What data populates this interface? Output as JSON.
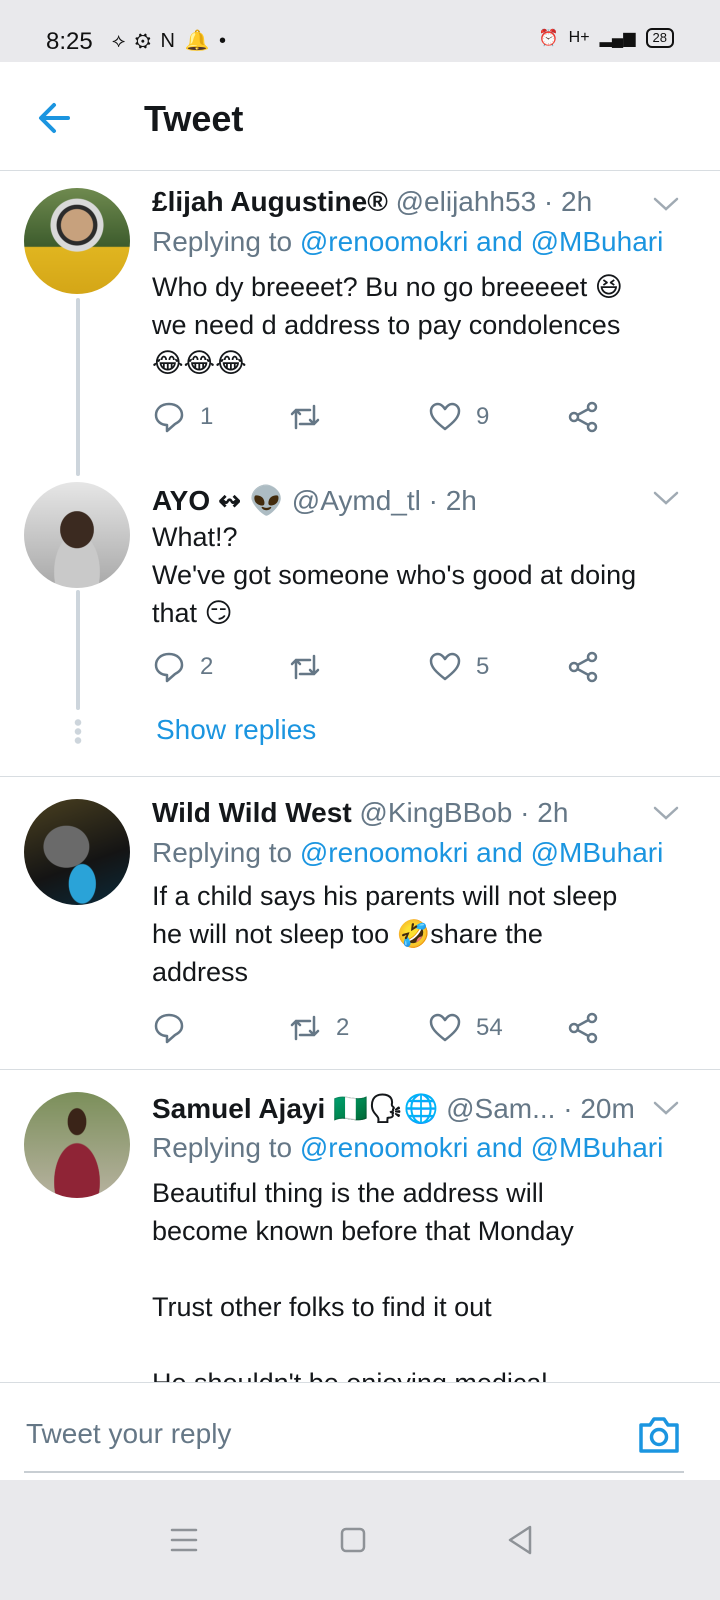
{
  "status_bar": {
    "time": "8:25",
    "left_icons": "⟡ ⚙ N 🔔 •",
    "network": "H+",
    "battery": "28"
  },
  "app_bar": {
    "title": "Tweet"
  },
  "tweets": [
    {
      "name": "£lijah Augustine®",
      "handle": "@elijahh53 · 2h",
      "replying_prefix": "Replying to ",
      "replying_mentions": "@renoomokri and @MBuhari",
      "body": "Who dy breeeet? Bu no go breeeeet 😆\nwe need d address to pay condolences\n😂😂😂",
      "replies": "1",
      "retweets": "",
      "likes": "9"
    },
    {
      "name": "AYO ↭ 👽",
      "handle": "@Aymd_tl · 2h",
      "body": "What!?\nWe've got someone who's good at doing\nthat 😏",
      "replies": "2",
      "retweets": "",
      "likes": "5",
      "show_replies": "Show replies"
    },
    {
      "name": "Wild Wild West",
      "handle": "@KingBBob · 2h",
      "replying_prefix": "Replying to ",
      "replying_mentions": "@renoomokri and @MBuhari",
      "body": "If a child says his parents will not sleep\nhe will not sleep too 🤣share the\naddress",
      "replies": "",
      "retweets": "2",
      "likes": "54"
    },
    {
      "name": "Samuel Ajayi 🇳🇬🗣🌐",
      "handle": "@Sam... · 20m",
      "replying_prefix": "Replying to ",
      "replying_mentions": "@renoomokri and @MBuhari",
      "body": "Beautiful thing is the address will\nbecome known before that Monday\n\nTrust other folks to find it out\n\nHe shouldn't be enjoying medical"
    }
  ],
  "reply_bar": {
    "placeholder": "Tweet your reply"
  },
  "colors": {
    "accent": "#1b95e0",
    "secondary_text": "#657786",
    "primary_text": "#14171a"
  },
  "icons": [
    "back-arrow-icon",
    "caret-down-icon",
    "reply-icon",
    "retweet-icon",
    "like-icon",
    "share-icon",
    "camera-icon",
    "menu-icon",
    "home-square-icon",
    "back-triangle-icon"
  ]
}
